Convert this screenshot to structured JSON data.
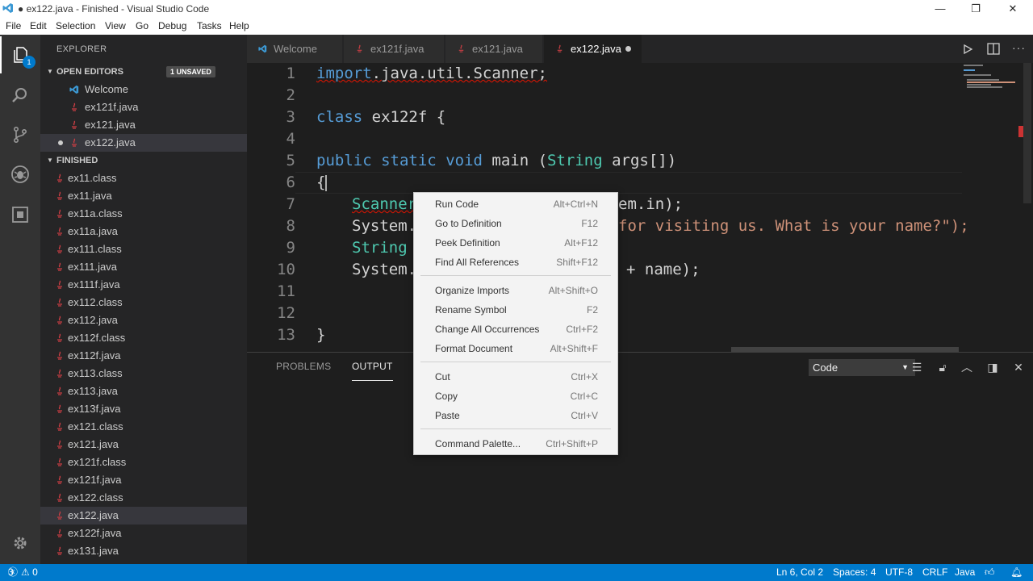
{
  "titlebar": {
    "title": "● ex122.java - Finished - Visual Studio Code",
    "minimize": "—",
    "maximize": "❐",
    "close": "✕"
  },
  "menu": [
    "File",
    "Edit",
    "Selection",
    "View",
    "Go",
    "Debug",
    "Tasks",
    "Help"
  ],
  "activity": {
    "explorer_badge": "1"
  },
  "sidebar": {
    "header": "EXPLORER",
    "open_editors": {
      "label": "OPEN EDITORS",
      "badge": "1 UNSAVED",
      "items": [
        "Welcome",
        "ex121f.java",
        "ex121.java",
        "ex122.java"
      ]
    },
    "folder": {
      "label": "FINISHED",
      "files": [
        "ex11.class",
        "ex11.java",
        "ex11a.class",
        "ex11a.java",
        "ex111.class",
        "ex111.java",
        "ex111f.java",
        "ex112.class",
        "ex112.java",
        "ex112f.class",
        "ex112f.java",
        "ex113.class",
        "ex113.java",
        "ex113f.java",
        "ex121.class",
        "ex121.java",
        "ex121f.class",
        "ex121f.java",
        "ex122.class",
        "ex122.java",
        "ex122f.java",
        "ex131.java"
      ]
    }
  },
  "tabs": [
    "Welcome",
    "ex121f.java",
    "ex121.java",
    "ex122.java"
  ],
  "editor": {
    "line_numbers": [
      "1",
      "2",
      "3",
      "4",
      "5",
      "6",
      "7",
      "8",
      "9",
      "10",
      "11",
      "12",
      "13"
    ],
    "lines": {
      "l1a": "import",
      "l1b": ".java.util.Scanner;",
      "l3a": "class",
      "l3b": " ex122f {",
      "l5a": "public",
      "l5b": " ",
      "l5c": "static",
      "l5d": " ",
      "l5e": "void",
      "l5f": " main (",
      "l5g": "String",
      "l5h": " args[])",
      "l6": "{",
      "l7a": "Scanner",
      "l7b": "em.in);",
      "l8a": "System.",
      "l8b": "for visiting us. What is your name?\");",
      "l9a": "String",
      "l10a": "System.",
      "l10b": "+ name);",
      "l13": "}"
    }
  },
  "context_menu": [
    {
      "label": "Run Code",
      "key": "Alt+Ctrl+N"
    },
    {
      "label": "Go to Definition",
      "key": "F12"
    },
    {
      "label": "Peek Definition",
      "key": "Alt+F12"
    },
    {
      "label": "Find All References",
      "key": "Shift+F12"
    },
    {
      "label": "Organize Imports",
      "key": "Alt+Shift+O"
    },
    {
      "label": "Rename Symbol",
      "key": "F2"
    },
    {
      "label": "Change All Occurrences",
      "key": "Ctrl+F2"
    },
    {
      "label": "Format Document",
      "key": "Alt+Shift+F"
    },
    {
      "label": "Cut",
      "key": "Ctrl+X"
    },
    {
      "label": "Copy",
      "key": "Ctrl+C"
    },
    {
      "label": "Paste",
      "key": "Ctrl+V"
    },
    {
      "label": "Command Palette...",
      "key": "Ctrl+Shift+P"
    }
  ],
  "panel": {
    "tabs": [
      "PROBLEMS",
      "OUTPUT"
    ],
    "select_value": "Code"
  },
  "status": {
    "errors": "3",
    "warnings": "0",
    "position": "Ln 6, Col 2",
    "spaces": "Spaces: 4",
    "encoding": "UTF-8",
    "eol": "CRLF",
    "language": "Java"
  },
  "colors": {
    "accent": "#007acc",
    "java_icon": "#cc3e44",
    "vscode_blue": "#3c99d4"
  }
}
